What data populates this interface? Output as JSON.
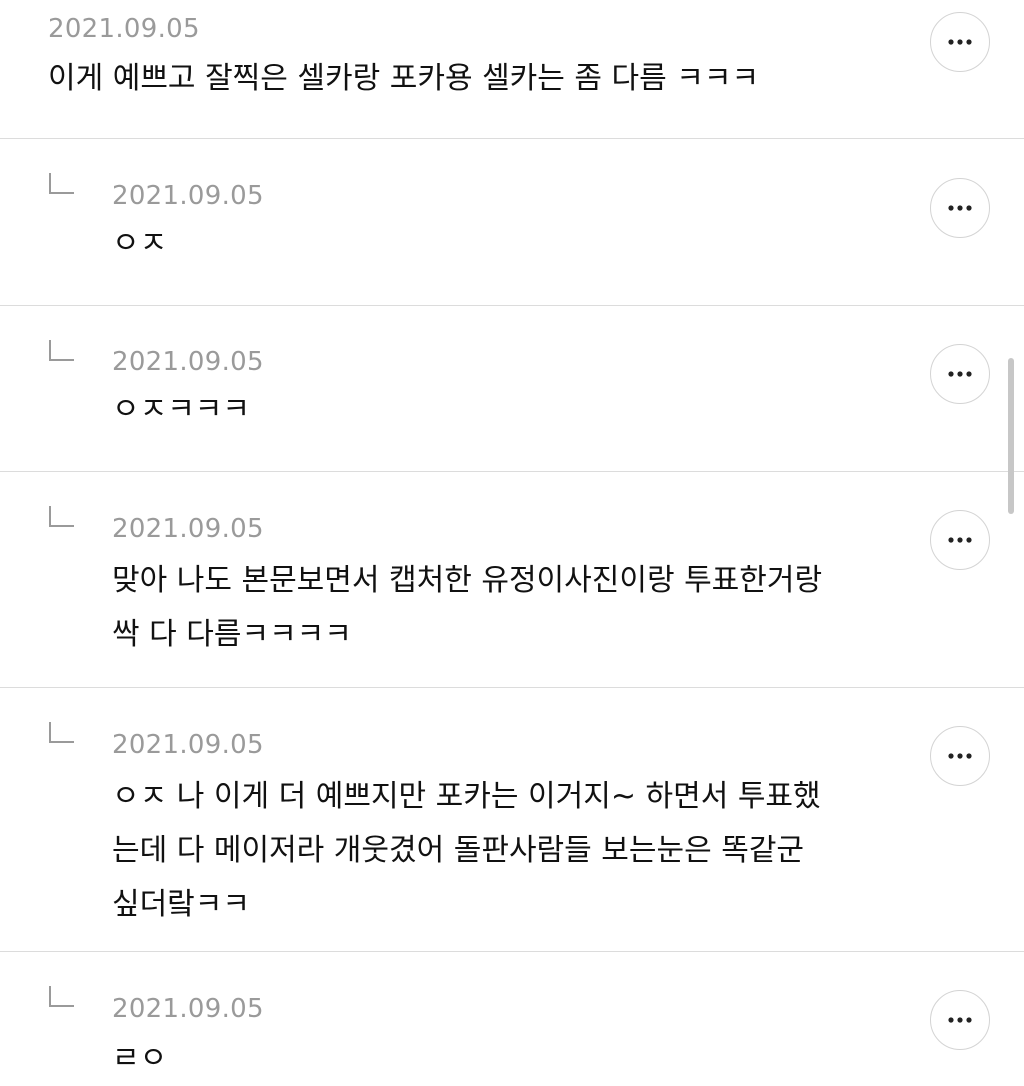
{
  "comments": [
    {
      "date": "2021.09.05",
      "text": "이게 예쁘고 잘찍은 셀카랑 포카용 셀카는 좀 다름 ㅋㅋㅋ",
      "is_reply": false,
      "more_icon": "more-horizontal-icon"
    },
    {
      "date": "2021.09.05",
      "text": "ㅇㅈ",
      "is_reply": true,
      "reply_icon": "reply-arrow-icon",
      "more_icon": "more-horizontal-icon"
    },
    {
      "date": "2021.09.05",
      "text": "ㅇㅈㅋㅋㅋ",
      "is_reply": true,
      "reply_icon": "reply-arrow-icon",
      "more_icon": "more-horizontal-icon"
    },
    {
      "date": "2021.09.05",
      "text": "맞아 나도 본문보면서 캡처한 유정이사진이랑 투표한거랑\n싹 다 다름ㅋㅋㅋㅋ",
      "is_reply": true,
      "reply_icon": "reply-arrow-icon",
      "more_icon": "more-horizontal-icon"
    },
    {
      "date": "2021.09.05",
      "text": "ㅇㅈ 나 이게 더 예쁘지만 포카는 이거지~ 하면서 투표했\n는데 다 메이저라 개웃겼어 돌판사람들 보는눈은 똑같군\n싶더랔ㅋㅋ",
      "is_reply": true,
      "reply_icon": "reply-arrow-icon",
      "more_icon": "more-horizontal-icon"
    },
    {
      "date": "2021.09.05",
      "text": "ㄹㅇ",
      "is_reply": true,
      "reply_icon": "reply-arrow-icon",
      "more_icon": "more-horizontal-icon"
    }
  ],
  "colors": {
    "date": "#9a9a9a",
    "text": "#111111",
    "divider": "#dcdcdc",
    "button_border": "#d4d4d4",
    "scrollbar": "#c7c7c7"
  }
}
